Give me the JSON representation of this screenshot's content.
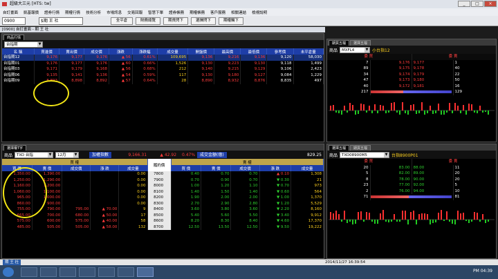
{
  "window": {
    "title": "超級大三元 [HTS: tw]",
    "minimize": "_",
    "maximize": "□",
    "close": "×"
  },
  "menu": [
    "自訂畫面",
    "凱基報價",
    "證券行情",
    "期權行情",
    "技術分析",
    "市場訊息",
    "交易回報",
    "智慧下單",
    "證券帳務",
    "期權帳務",
    "客戶服務",
    "相關連結",
    "檢視說明"
  ],
  "toolbar": {
    "code": "0900",
    "account": "$期 王 社",
    "buttons": [
      "全平倉",
      "財務總覽",
      "期貨閃下",
      "選擇閃下",
      "期權觸下"
    ]
  },
  "futures_panel": {
    "window_title": "[0900] 自訂畫面 - 期 王 社",
    "tabs": [
      "商品行情"
    ],
    "selector": "台指期",
    "columns": [
      "名 稱",
      "買進價",
      "賣出價",
      "成交價",
      "漲跌",
      "漲跌幅",
      "成交量",
      "開盤價",
      "最高價",
      "最低價",
      "參考價",
      "未平倉量"
    ],
    "rows": [
      {
        "name": "台指期12",
        "bid": "9,176",
        "ask": "9,177",
        "last": "9,176",
        "chg": "▲ 56",
        "pct": "0.61%",
        "vol": "109,695",
        "open": "9,136",
        "high": "9,216",
        "low": "9,136",
        "ref": "9,120",
        "oi": "58,030"
      },
      {
        "name": "台指期01",
        "bid": "9,176",
        "ask": "9,177",
        "last": "9,176",
        "chg": "▲ 60",
        "pct": "0.66%",
        "vol": "1,526",
        "open": "9,130",
        "high": "9,223",
        "low": "9,130",
        "ref": "9,118",
        "oi": "1,499"
      },
      {
        "name": "台指期03",
        "bid": "9,171",
        "ask": "9,179",
        "last": "9,168",
        "chg": "▲ 56",
        "pct": "0.68%",
        "vol": "212",
        "open": "9,140",
        "high": "9,215",
        "low": "9,129",
        "ref": "9,106",
        "oi": "2,423"
      },
      {
        "name": "台指期06",
        "bid": "9,135",
        "ask": "9,141",
        "last": "9,136",
        "chg": "▲ 54",
        "pct": "0.59%",
        "vol": "117",
        "open": "9,130",
        "high": "9,180",
        "low": "9,127",
        "ref": "9,084",
        "oi": "1,229"
      },
      {
        "name": "台指期09",
        "bid": "8,893",
        "ask": "8,898",
        "last": "8,892",
        "chg": "▲ 57",
        "pct": "0.64%",
        "vol": "28",
        "open": "8,890",
        "high": "8,932",
        "low": "8,876",
        "ref": "8,835",
        "oi": "497"
      }
    ]
  },
  "mxf_panel": {
    "tabs": [
      "期貨五檔",
      "選擇五檔"
    ],
    "label": "商品",
    "product": "MXFL4",
    "name": "小台指12",
    "headers": [
      "委 買",
      "委 賣"
    ],
    "rows": [
      {
        "bq": "7",
        "bp": "9,176",
        "ap": "9,177",
        "aq": "1"
      },
      {
        "bq": "89",
        "bp": "9,175",
        "ap": "9,178",
        "aq": "40"
      },
      {
        "bq": "34",
        "bp": "9,174",
        "ap": "9,179",
        "aq": "22"
      },
      {
        "bq": "47",
        "bp": "9,173",
        "ap": "9,180",
        "aq": "50"
      },
      {
        "bq": "40",
        "bp": "9,172",
        "ap": "9,181",
        "aq": "16"
      }
    ],
    "total_bid": "217",
    "total_ask": "129"
  },
  "options_panel": {
    "tabs": [
      "選擇權T字"
    ],
    "label": "商品",
    "product": "TXO 台指",
    "month": "12月",
    "index_label": "加權指數",
    "index_value": "9,166.31",
    "index_chg": "▲ 42.92",
    "index_pct": "0.47%",
    "amount_label": "成交金額(億)",
    "amount_value": "829.25",
    "call_title": "買 權",
    "put_title": "賣 權",
    "strike_title": "履約價",
    "call_cols": [
      "買 價",
      "賣 價",
      "成交價",
      "漲 跌",
      "成交量"
    ],
    "put_cols": [
      "買 價",
      "賣 價",
      "成交價",
      "漲 跌",
      "成交量"
    ],
    "rows": [
      {
        "c": [
          "1,350.00",
          "1,390.00",
          "",
          "",
          "0.00"
        ],
        "k": "7800",
        "p": [
          "0.40",
          "0.70",
          "0.70",
          "▲ 0.10",
          "1,308"
        ]
      },
      {
        "c": [
          "1,250.00",
          "1,290.00",
          "",
          "",
          "0.00"
        ],
        "k": "7900",
        "p": [
          "0.70",
          "0.90",
          "0.70",
          "▼ 0.30",
          "21"
        ]
      },
      {
        "c": [
          "1,160.00",
          "1,200.00",
          "",
          "",
          "0.00"
        ],
        "k": "8000",
        "p": [
          "1.00",
          "1.20",
          "1.10",
          "▼ 0.70",
          "973"
        ]
      },
      {
        "c": [
          "1,060.00",
          "1,100.00",
          "",
          "",
          "0.00"
        ],
        "k": "8100",
        "p": [
          "1.40",
          "1.50",
          "1.40",
          "▼ 0.60",
          "564"
        ]
      },
      {
        "c": [
          "965.00",
          "1,000.00",
          "",
          "",
          "0.00"
        ],
        "k": "8200",
        "p": [
          "1.90",
          "2.00",
          "2.00",
          "▼ 1.00",
          "1,370"
        ]
      },
      {
        "c": [
          "860.00",
          "900.00",
          "",
          "",
          "0.00"
        ],
        "k": "8300",
        "p": [
          "2.70",
          "2.90",
          "2.80",
          "▼ 1.20",
          "5,529"
        ]
      },
      {
        "c": [
          "755.00",
          "790.00",
          "795.00",
          "▲ 70.00",
          "9"
        ],
        "k": "8400",
        "p": [
          "3.60",
          "3.80",
          "3.60",
          "▼ 2.20",
          "8,160"
        ]
      },
      {
        "c": [
          "665.00",
          "700.00",
          "680.00",
          "▲ 50.00",
          "17"
        ],
        "k": "8500",
        "p": [
          "5.40",
          "5.60",
          "5.50",
          "▼ 3.40",
          "9,912"
        ]
      },
      {
        "c": [
          "575.00",
          "600.00",
          "575.00",
          "▲ 40.00",
          "58"
        ],
        "k": "8600",
        "p": [
          "8.20",
          "8.30",
          "8.40",
          "▼ 4.60",
          "17,370"
        ]
      },
      {
        "c": [
          "485.00",
          "505.00",
          "505.00",
          "▲ 58.00",
          "132"
        ],
        "k": "8700",
        "p": [
          "12.50",
          "13.50",
          "12.50",
          "▼ 9.50",
          "19,222"
        ]
      }
    ]
  },
  "txo_panel": {
    "tabs": [
      "選擇五檔",
      "期貨五檔"
    ],
    "label": "商品",
    "product": "TXO08900M5",
    "name": "台指8900P01",
    "headers": [
      "委 買",
      "委 賣"
    ],
    "rows": [
      {
        "bq": "20",
        "bp": "83.00",
        "ap": "88.00",
        "aq": "11"
      },
      {
        "bq": "5",
        "bp": "82.00",
        "ap": "89.00",
        "aq": "20"
      },
      {
        "bq": "8",
        "bp": "78.00",
        "ap": "90.00",
        "aq": "20"
      },
      {
        "bq": "23",
        "bp": "77.00",
        "ap": "92.00",
        "aq": "5"
      },
      {
        "bq": "2",
        "bp": "76.00",
        "ap": "94.00",
        "aq": "10"
      }
    ],
    "total_bid": "71",
    "total_ask": "81"
  },
  "status": {
    "left": "期 王 社",
    "datetime": "2014/11/27  16:39:54"
  },
  "taskbar": {
    "clock": "PM 04:39"
  },
  "colors": {
    "header_blue": "#1e3ea8",
    "up_red": "#ff3b3b",
    "down_green": "#2fd12f",
    "highlight_yellow": "#f3e615"
  }
}
